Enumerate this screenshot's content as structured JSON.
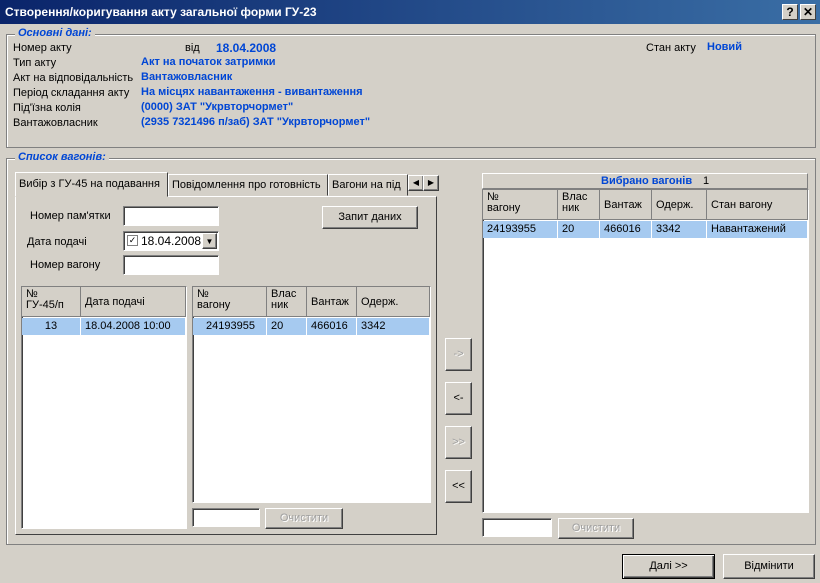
{
  "window": {
    "title": "Створення/коригування акту загальної форми ГУ-23",
    "help_label": "?",
    "close_label": "✕"
  },
  "main": {
    "legend": "Основні дані:",
    "act_number_label": "Номер акту",
    "date_from_label": "від",
    "date_value": "18.04.2008",
    "state_label": "Стан акту",
    "state_value": "Новий",
    "rows": [
      {
        "label": "Тип акту",
        "value": "Акт на початок затримки"
      },
      {
        "label": "Акт на відповідальність",
        "value": "Вантажовласник"
      },
      {
        "label": "Період складання акту",
        "value": "На місцях навантаження - вивантаження"
      },
      {
        "label": "Під'їзна колія",
        "value": "(0000) ЗАТ \"Укрвторчормет\""
      },
      {
        "label": "Вантажовласник",
        "value": "(2935 7321496 п/заб) ЗАТ \"Укрвторчормет\""
      }
    ]
  },
  "wagons": {
    "legend": "Список вагонів:",
    "tabs": [
      "Вибір з ГУ-45 на подавання",
      "Повідомлення про готовність",
      "Вагони на під"
    ],
    "tab_left": "◀",
    "tab_right": "▶",
    "memo_label": "Номер пам'ятки",
    "date_label": "Дата подачі",
    "date_value": "18.04.2008",
    "date_check": "✓",
    "date_arrow": "▼",
    "wagon_label": "Номер вагону",
    "query_button": "Запит даних",
    "gu45_headers": [
      "№\nГУ-45/п",
      "Дата подачі"
    ],
    "gu45_rows": [
      [
        "13",
        "18.04.2008 10:00"
      ]
    ],
    "found_headers": [
      "№\nвагону",
      "Влас\nник",
      "Вантаж",
      "Одерж."
    ],
    "found_rows": [
      [
        "24193955",
        "20",
        "466016",
        "3342"
      ]
    ],
    "clear_label": "Очистити",
    "move_buttons": [
      "->",
      "<-",
      ">>",
      "<<"
    ],
    "selected_title": "Вибрано вагонів",
    "selected_count": "1",
    "selected_headers": [
      "№\nвагону",
      "Влас\nник",
      "Вантаж",
      "Одерж.",
      "Стан вагону"
    ],
    "selected_rows": [
      [
        "24193955",
        "20",
        "466016",
        "3342",
        "Навантажений"
      ]
    ],
    "clear_label_right": "Очистити"
  },
  "footer": {
    "next_button": "Далі >>",
    "cancel_button": "Відмінити"
  }
}
